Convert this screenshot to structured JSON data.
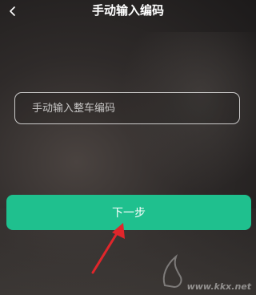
{
  "header": {
    "back_icon": "chevron-left-icon",
    "title": "手动输入编码"
  },
  "form": {
    "code_input": {
      "value": "",
      "placeholder": "手动输入整车编码"
    },
    "next_label": "下一步"
  },
  "annotation": {
    "arrow_icon": "red-arrow-icon",
    "arrow_color": "#e0262b"
  },
  "watermark": {
    "text": "www.kkx.net"
  },
  "colors": {
    "accent": "#1fc08e"
  }
}
